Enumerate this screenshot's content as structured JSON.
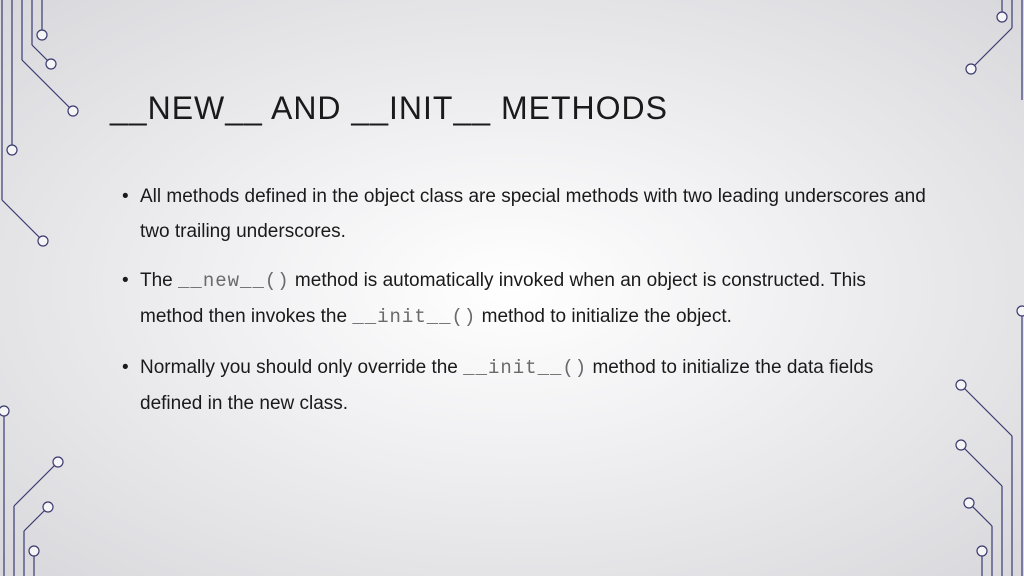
{
  "title": "__NEW__ AND __INIT__ METHODS",
  "bullets": {
    "b1": "All methods defined in the object class are special methods with two leading underscores and two trailing underscores.",
    "b2a": "The ",
    "b2code1": "__new__()",
    "b2b": " method is automatically invoked when an object is constructed. This method then invokes the ",
    "b2code2": "__init__()",
    "b2c": " method to initialize the object.",
    "b3a": " Normally you should only override the ",
    "b3code1": "__init__()",
    "b3b": " method to initialize the data fields defined in the new class."
  },
  "decor_color": "#3a3a70"
}
